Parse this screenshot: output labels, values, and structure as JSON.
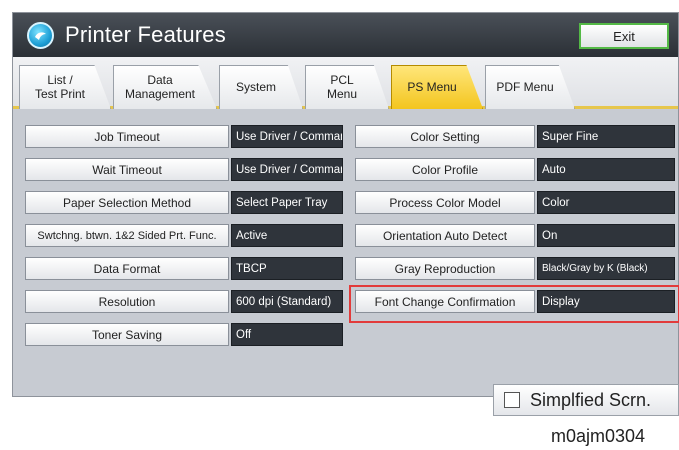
{
  "window": {
    "title": "Printer Features",
    "exit_label": "Exit"
  },
  "tabs": [
    {
      "label": "List /\nTest Print",
      "active": false
    },
    {
      "label": "Data\nManagement",
      "active": false
    },
    {
      "label": "System",
      "active": false
    },
    {
      "label": "PCL\nMenu",
      "active": false
    },
    {
      "label": "PS Menu",
      "active": true
    },
    {
      "label": "PDF Menu",
      "active": false
    }
  ],
  "left_settings": [
    {
      "label": "Job Timeout",
      "value": "Use Driver / Command"
    },
    {
      "label": "Wait Timeout",
      "value": "Use Driver / Command"
    },
    {
      "label": "Paper Selection Method",
      "value": "Select Paper Tray"
    },
    {
      "label": "Swtchng. btwn. 1&2 Sided Prt. Func.",
      "value": "Active"
    },
    {
      "label": "Data Format",
      "value": "TBCP"
    },
    {
      "label": "Resolution",
      "value": "600 dpi (Standard)"
    },
    {
      "label": "Toner Saving",
      "value": "Off"
    }
  ],
  "right_settings": [
    {
      "label": "Color Setting",
      "value": "Super Fine"
    },
    {
      "label": "Color Profile",
      "value": "Auto"
    },
    {
      "label": "Process Color Model",
      "value": "Color"
    },
    {
      "label": "Orientation Auto Detect",
      "value": "On"
    },
    {
      "label": "Gray Reproduction",
      "value": "Black/Gray by K (Black)"
    },
    {
      "label": "Font Change Confirmation",
      "value": "Display"
    }
  ],
  "footer": {
    "simplified_label": "Simplfied Scrn.",
    "figure_code": "m0ajm0304"
  },
  "colors": {
    "highlight": "#e23b3b",
    "active_tab": "#f3c51e",
    "exit_border": "#54b946"
  }
}
